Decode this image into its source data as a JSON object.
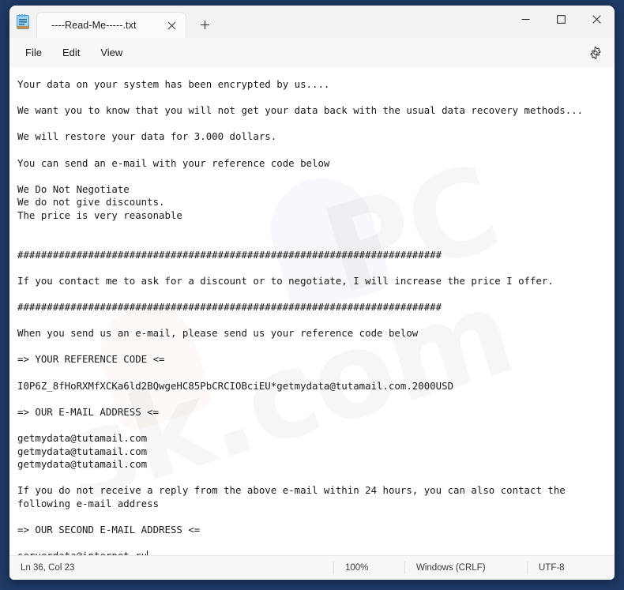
{
  "window": {
    "app_icon": "notepad-icon",
    "minimize_label": "—",
    "maximize_label": "□",
    "close_label": "✕"
  },
  "tab": {
    "title": "----Read-Me-----.txt",
    "close_label": "✕",
    "new_tab_label": "+"
  },
  "menubar": {
    "items": [
      {
        "label": "File"
      },
      {
        "label": "Edit"
      },
      {
        "label": "View"
      }
    ],
    "settings_icon": "gear-icon"
  },
  "editor": {
    "lines": [
      "Your data on your system has been encrypted by us....",
      "",
      "We want you to know that you will not get your data back with the usual data recovery methods...",
      "",
      "We will restore your data for 3.000 dollars.",
      "",
      "You can send an e-mail with your reference code below",
      "",
      "We Do Not Negotiate",
      "We do not give discounts.",
      "The price is very reasonable",
      "",
      "",
      "########################################################################",
      "",
      "If you contact me to ask for a discount or to negotiate, I will increase the price I offer.",
      "",
      "########################################################################",
      "",
      "When you send us an e-mail, please send us your reference code below",
      "",
      "=> YOUR REFERENCE CODE <=",
      "",
      "I0P6Z_8fHoRXMfXCKa6ld2BQwgeHC85PbCRCIOBciEU*getmydata@tutamail.com.2000USD",
      "",
      "=> OUR E-MAIL ADDRESS <=",
      "",
      "getmydata@tutamail.com",
      "getmydata@tutamail.com",
      "getmydata@tutamail.com",
      "",
      "If you do not receive a reply from the above e-mail within 24 hours, you can also contact the",
      "following e-mail address",
      "",
      "=> OUR SECOND E-MAIL ADDRESS <=",
      "",
      "serverdata@internet.ru"
    ],
    "watermark_1": "PC",
    "watermark_2": "sk.com"
  },
  "statusbar": {
    "position": "Ln 36, Col 23",
    "zoom": "100%",
    "line_ending": "Windows (CRLF)",
    "encoding": "UTF-8"
  },
  "colors": {
    "desktop": "#1f3a66",
    "window_chrome": "#f3f3f3",
    "editor_bg": "#ffffff",
    "text": "#1a1a1a",
    "accent_close_hover": "#c42b1c"
  }
}
